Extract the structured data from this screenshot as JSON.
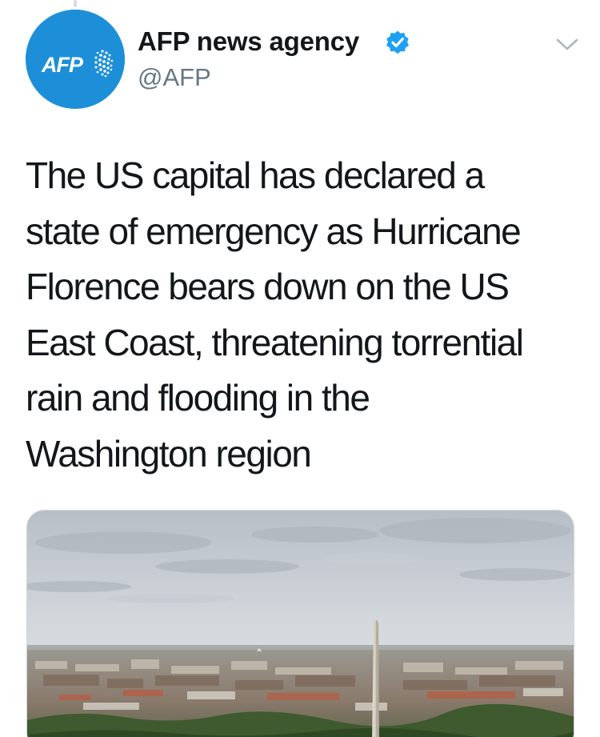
{
  "tweet": {
    "author": {
      "display_name": "AFP news agency",
      "handle": "@AFP",
      "verified": true,
      "avatar_text": "AFP",
      "avatar_color": "#1d8fd8"
    },
    "text_lines": [
      "The US capital has declared a",
      "state of emergency as Hurricane",
      "Florence bears down on the US",
      "East Coast, threatening torrential",
      "rain and flooding in the",
      "Washington region"
    ],
    "menu_icon": "chevron-down-icon",
    "verified_icon": "verified-badge-icon",
    "colors": {
      "text": "#14171a",
      "secondary": "#657786",
      "verified": "#1da1f2"
    },
    "media": {
      "subject": "Washington Monument and Washington DC skyline under cloudy sky"
    }
  }
}
